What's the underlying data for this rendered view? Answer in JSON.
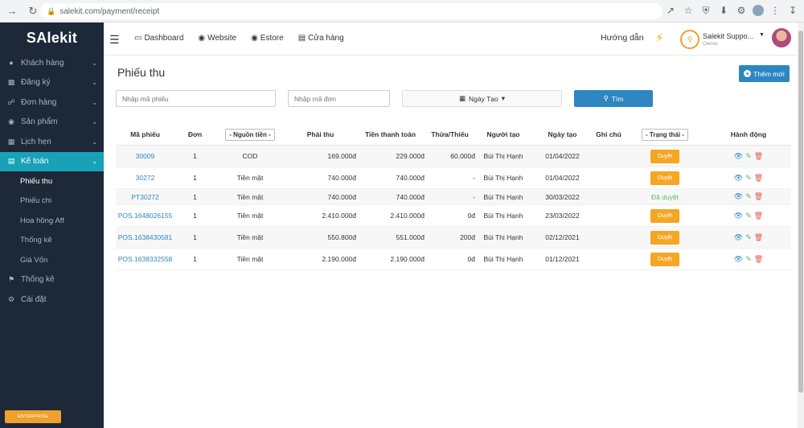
{
  "browser": {
    "url": "salekit.com/payment/receipt"
  },
  "sidebar": {
    "logo_prefix": "SA",
    "logo_suffix": "lekit",
    "items": [
      {
        "label": "Khách hàng",
        "icon": "user-icon"
      },
      {
        "label": "Đăng ký",
        "icon": "id-card-icon"
      },
      {
        "label": "Đơn hàng",
        "icon": "cart-icon"
      },
      {
        "label": "Sản phẩm",
        "icon": "box-icon"
      },
      {
        "label": "Lịch hẹn",
        "icon": "calendar-icon"
      },
      {
        "label": "Kế toán",
        "icon": "credit-card-icon",
        "active": true
      }
    ],
    "submenu": [
      "Phiếu thu",
      "Phiếu chi",
      "Hoa hồng Aff",
      "Thống kê",
      "Giá Vốn"
    ],
    "bottom_items": [
      {
        "label": "Thống kê",
        "icon": "flag-icon"
      },
      {
        "label": "Cài đặt",
        "icon": "gear-icon"
      }
    ],
    "enterprise_label": "ENTERPRISE"
  },
  "topbar": {
    "nav": [
      {
        "label": "Dashboard",
        "icon": "monitor-icon"
      },
      {
        "label": "Website",
        "icon": "globe-icon"
      },
      {
        "label": "Estore",
        "icon": "globe-icon"
      },
      {
        "label": "Cửa hàng",
        "icon": "store-icon"
      }
    ],
    "guide": "Hướng dẫn",
    "account_name": "Salekit Suppo...",
    "account_role": "Owner"
  },
  "page": {
    "title": "Phiếu thu",
    "add_label": "Thêm mới",
    "code_placeholder": "Nhập mã phiếu",
    "order_placeholder": "Nhập mã đơn",
    "date_label": "Ngày Tạo",
    "search_label": "Tìm"
  },
  "table": {
    "headers": {
      "code": "Mã phiếu",
      "order": "Đơn",
      "source": "- Nguồn tiền -",
      "pay": "Phải thu",
      "paid": "Tiền thanh toán",
      "diff": "Thừa/Thiếu",
      "creator": "Người tạo",
      "date": "Ngày tạo",
      "note": "Ghi chú",
      "status": "- Trạng thái -",
      "actions": "Hành động"
    },
    "rows": [
      {
        "code": "30009",
        "order": "1",
        "source": "COD",
        "pay": "169.000đ",
        "paid": "229.000đ",
        "diff": "60.000đ",
        "creator": "Bùi Thị Hạnh",
        "date": "01/04/2022",
        "note": "",
        "status": "Duyệt",
        "status_done": false
      },
      {
        "code": "30272",
        "order": "1",
        "source": "Tiền mặt",
        "pay": "740.000đ",
        "paid": "740.000đ",
        "diff": "-",
        "creator": "Bùi Thị Hạnh",
        "date": "01/04/2022",
        "note": "",
        "status": "Duyệt",
        "status_done": false
      },
      {
        "code": "PT30272",
        "order": "1",
        "source": "Tiền mặt",
        "pay": "740.000đ",
        "paid": "740.000đ",
        "diff": "-",
        "creator": "Bùi Thị Hạnh",
        "date": "30/03/2022",
        "note": "",
        "status": "Đã duyệt",
        "status_done": true
      },
      {
        "code": "POS.1648026155",
        "order": "1",
        "source": "Tiền mặt",
        "pay": "2.410.000đ",
        "paid": "2.410.000đ",
        "diff": "0đ",
        "creator": "Bùi Thị Hạnh",
        "date": "23/03/2022",
        "note": "",
        "status": "Duyệt",
        "status_done": false
      },
      {
        "code": "POS.1638430581",
        "order": "1",
        "source": "Tiền mặt",
        "pay": "550.800đ",
        "paid": "551.000đ",
        "diff": "200đ",
        "creator": "Bùi Thị Hạnh",
        "date": "02/12/2021",
        "note": "",
        "status": "Duyệt",
        "status_done": false
      },
      {
        "code": "POS.1638332558",
        "order": "1",
        "source": "Tiền mặt",
        "pay": "2.190.000đ",
        "paid": "2.190.000đ",
        "diff": "0đ",
        "creator": "Bùi Thị Hạnh",
        "date": "01/12/2021",
        "note": "",
        "status": "Duyệt",
        "status_done": false
      }
    ]
  }
}
